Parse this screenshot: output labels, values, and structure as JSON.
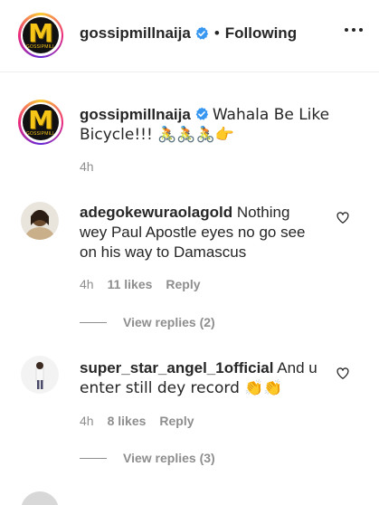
{
  "header": {
    "username": "gossipmillnaija",
    "separator": "•",
    "follow_status": "Following",
    "more_icon": "more-horizontal-icon"
  },
  "caption": {
    "username": "gossipmillnaija",
    "text": "Wahala Be Like Bicycle!!! 🚴🚴🚴👉",
    "time": "4h"
  },
  "comments": [
    {
      "username": "adegokewuraolagold",
      "text_line1": "Nothing",
      "text_line2": "wey Paul Apostle eyes no go see",
      "text_line3": "on his way to Damascus",
      "time": "4h",
      "likes": "11 likes",
      "reply": "Reply",
      "view_replies": "View replies (2)"
    },
    {
      "username": "super_star_angel_1official",
      "text_line1": "And u",
      "text_line2": "enter still dey record 👏👏",
      "time": "4h",
      "likes": "8 likes",
      "reply": "Reply",
      "view_replies": "View replies (3)"
    }
  ],
  "logo": {
    "letter": "M",
    "subtitle": "GOSSIPMILL"
  },
  "colors": {
    "text": "#262626",
    "muted": "#8e8e8e",
    "verified": "#3897f0",
    "border": "#efefef"
  }
}
